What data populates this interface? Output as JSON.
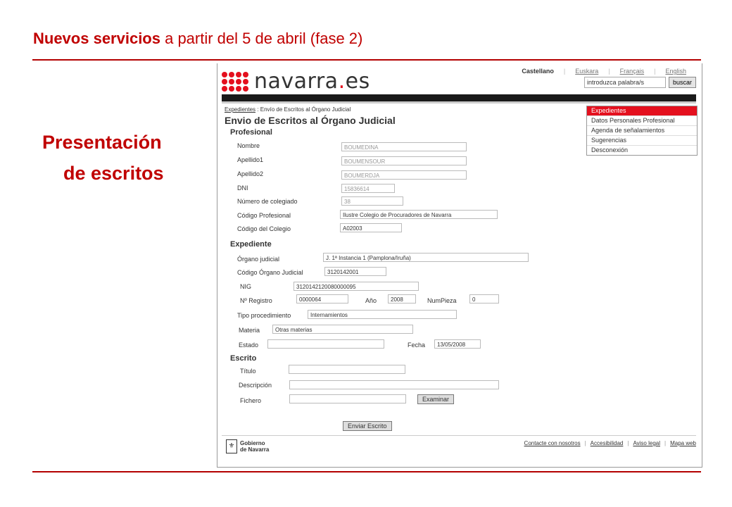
{
  "slide": {
    "title_bold": "Nuevos servicios",
    "title_rest": " a partir del 5 de abril (fase 2)",
    "side_line1": "Presentación",
    "side_line2": "de escritos"
  },
  "site": {
    "logo_text_a": "navarra",
    "logo_text_dot": ".",
    "logo_text_b": "es",
    "languages": [
      "Castellano",
      "Euskara",
      "Français",
      "English"
    ],
    "search_placeholder": "introduzca palabra/s",
    "search_button": "buscar"
  },
  "breadcrumb": {
    "link": "Expedientes",
    "sep": ":",
    "current": "Envío de Escritos al Órgano Judicial"
  },
  "page_title": "Envio de Escritos al Órgano Judicial",
  "menu": [
    "Expedientes",
    "Datos Personales Profesional",
    "Agenda de señalamientos",
    "Sugerencias",
    "Desconexión"
  ],
  "profesional": {
    "heading": "Profesional",
    "nombre_label": "Nombre",
    "nombre_value": "BOUMEDINA",
    "apellido1_label": "Apellido1",
    "apellido1_value": "BOUMENSOUR",
    "apellido2_label": "Apellido2",
    "apellido2_value": "BOUMERDJA",
    "dni_label": "DNI",
    "dni_value": "15836614",
    "colegiado_label": "Número de colegiado",
    "colegiado_value": "38",
    "codprof_label": "Código Profesional",
    "codprof_value": "Ilustre Colegio de Procuradores de Navarra",
    "codcol_label": "Código del Colegio",
    "codcol_value": "A02003"
  },
  "expediente": {
    "heading": "Expediente",
    "organo_label": "Órgano judicial",
    "organo_value": "J. 1ª Instancia 1 (Pamplona/Iruña)",
    "codorg_label": "Código Órgano Judicial",
    "codorg_value": "3120142001",
    "nig_label": "NIG",
    "nig_value": "3120142120080000095",
    "registro_label": "Nº Registro",
    "registro_value": "0000064",
    "anio_label": "Año",
    "anio_value": "2008",
    "numpieza_label": "NumPieza",
    "numpieza_value": "0",
    "tipo_label": "Tipo procedimiento",
    "tipo_value": "Internamientos",
    "materia_label": "Materia",
    "materia_value": "Otras materias",
    "estado_label": "Estado",
    "estado_value": "",
    "fecha_label": "Fecha",
    "fecha_value": "13/05/2008"
  },
  "escrito": {
    "heading": "Escrito",
    "titulo_label": "Título",
    "descripcion_label": "Descripción",
    "fichero_label": "Fichero",
    "examinar_button": "Examinar",
    "enviar_button": "Enviar Escrito"
  },
  "footer": {
    "gob_line1": "Gobierno",
    "gob_line2": "de Navarra",
    "links": [
      "Contacte con nosotros",
      "Accesibilidad",
      "Aviso legal",
      "Mapa web"
    ],
    "link_sep": "|"
  }
}
